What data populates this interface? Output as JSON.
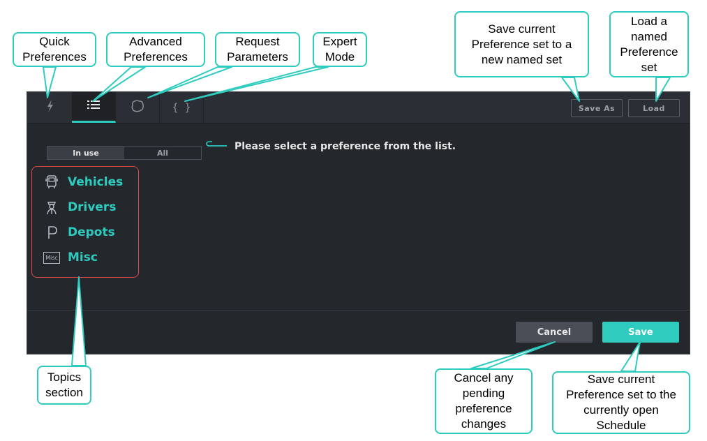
{
  "tabs": {
    "quick_icon": "lightning-icon",
    "advanced_icon": "list-icon",
    "request_icon": "globe-icon",
    "expert_label": "{ }"
  },
  "toolbar": {
    "save_as_label": "Save As",
    "load_label": "Load"
  },
  "filter": {
    "in_use_label": "In use",
    "all_label": "All",
    "selected": "In use"
  },
  "prompt": "Please select a preference from the list.",
  "topics": [
    {
      "label": "Vehicles",
      "icon": "bus-icon"
    },
    {
      "label": "Drivers",
      "icon": "driver-icon"
    },
    {
      "label": "Depots",
      "icon": "parking-icon"
    },
    {
      "label": "Misc",
      "icon": "misc-icon",
      "icon_text": "Misc"
    }
  ],
  "actions": {
    "cancel_label": "Cancel",
    "save_label": "Save"
  },
  "callouts": {
    "quick": "Quick\nPreferences",
    "advanced": "Advanced\nPreferences",
    "request": "Request\nParameters",
    "expert": "Expert\nMode",
    "save_as": "Save current\nPreference set to a\nnew named set",
    "load": "Load a\nnamed\nPreference\nset",
    "topics": "Topics\nsection",
    "cancel": "Cancel any\npending\npreference\nchanges",
    "save": "Save current\nPreference set to  the\ncurrently open\nSchedule"
  },
  "colors": {
    "accent": "#2ecbbf",
    "panel_bg": "#24272c",
    "highlight_border": "#e04848",
    "cancel_bg": "#4a4f57"
  }
}
